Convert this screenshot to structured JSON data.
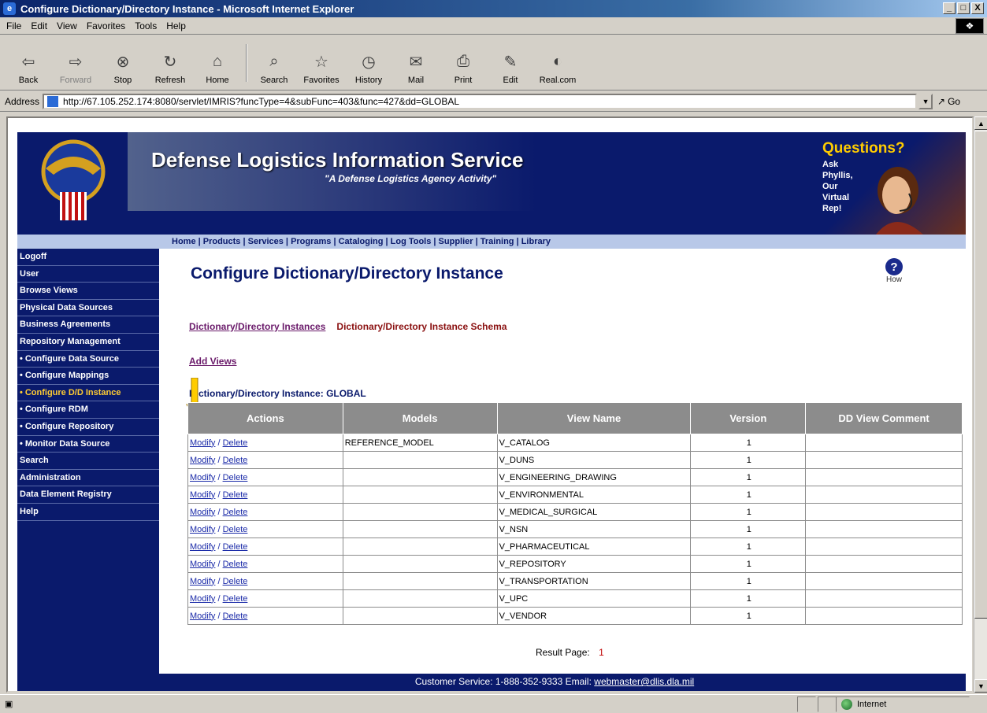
{
  "window": {
    "title": "Configure Dictionary/Directory Instance - Microsoft Internet Explorer",
    "controls": [
      "_",
      "□",
      "X"
    ]
  },
  "menubar": [
    "File",
    "Edit",
    "View",
    "Favorites",
    "Tools",
    "Help"
  ],
  "toolbar": {
    "back": "Back",
    "forward": "Forward",
    "stop": "Stop",
    "refresh": "Refresh",
    "home": "Home",
    "search": "Search",
    "favorites": "Favorites",
    "history": "History",
    "mail": "Mail",
    "print": "Print",
    "edit": "Edit",
    "real": "Real.com"
  },
  "address": {
    "label": "Address",
    "url": "http://67.105.252.174:8080/servlet/IMRIS?funcType=4&subFunc=403&func=427&dd=GLOBAL",
    "go": "Go"
  },
  "banner": {
    "title": "Defense Logistics Information Service",
    "subtitle": "\"A Defense Logistics Agency Activity\"",
    "questions_title": "Questions?",
    "questions_text": "Ask Phyllis, Our Virtual Rep!"
  },
  "nav": "Home | Products | Services | Programs | Cataloging | Log Tools | Supplier | Training | Library",
  "sidebar": [
    {
      "label": "Logoff",
      "sub": false,
      "active": false
    },
    {
      "label": "User",
      "sub": false,
      "active": false
    },
    {
      "label": "Browse Views",
      "sub": false,
      "active": false
    },
    {
      "label": "Physical Data Sources",
      "sub": false,
      "active": false
    },
    {
      "label": "Business Agreements",
      "sub": false,
      "active": false
    },
    {
      "label": "Repository Management",
      "sub": false,
      "active": false
    },
    {
      "label": "Configure Data Source",
      "sub": true,
      "active": false
    },
    {
      "label": "Configure Mappings",
      "sub": true,
      "active": false
    },
    {
      "label": "Configure D/D Instance",
      "sub": true,
      "active": true
    },
    {
      "label": "Configure RDM",
      "sub": true,
      "active": false
    },
    {
      "label": "Configure Repository",
      "sub": true,
      "active": false
    },
    {
      "label": "Monitor Data Source",
      "sub": true,
      "active": false
    },
    {
      "label": "Search",
      "sub": false,
      "active": false
    },
    {
      "label": "Administration",
      "sub": false,
      "active": false
    },
    {
      "label": "Data Element Registry",
      "sub": false,
      "active": false
    },
    {
      "label": "Help",
      "sub": false,
      "active": false
    }
  ],
  "main": {
    "title": "Configure Dictionary/Directory Instance",
    "help_label": "How",
    "tab_instances": "Dictionary/Directory Instances",
    "tab_schema": "Dictionary/Directory Instance Schema",
    "add_views": "Add Views",
    "instance_label": "Dictionary/Directory Instance:",
    "instance_value": "GLOBAL",
    "columns": [
      "Actions",
      "Models",
      "View Name",
      "Version",
      "DD View Comment"
    ],
    "modify_label": "Modify",
    "delete_label": "Delete",
    "rows": [
      {
        "model": "REFERENCE_MODEL",
        "view": "V_CATALOG",
        "version": "1",
        "comment": ""
      },
      {
        "model": "",
        "view": "V_DUNS",
        "version": "1",
        "comment": ""
      },
      {
        "model": "",
        "view": "V_ENGINEERING_DRAWING",
        "version": "1",
        "comment": ""
      },
      {
        "model": "",
        "view": "V_ENVIRONMENTAL",
        "version": "1",
        "comment": ""
      },
      {
        "model": "",
        "view": "V_MEDICAL_SURGICAL",
        "version": "1",
        "comment": ""
      },
      {
        "model": "",
        "view": "V_NSN",
        "version": "1",
        "comment": ""
      },
      {
        "model": "",
        "view": "V_PHARMACEUTICAL",
        "version": "1",
        "comment": ""
      },
      {
        "model": "",
        "view": "V_REPOSITORY",
        "version": "1",
        "comment": ""
      },
      {
        "model": "",
        "view": "V_TRANSPORTATION",
        "version": "1",
        "comment": ""
      },
      {
        "model": "",
        "view": "V_UPC",
        "version": "1",
        "comment": ""
      },
      {
        "model": "",
        "view": "V_VENDOR",
        "version": "1",
        "comment": ""
      }
    ],
    "result_page_label": "Result Page:",
    "result_page_num": "1"
  },
  "footer": {
    "text": "Customer Service: 1-888-352-9333 Email:",
    "email": "webmaster@dlis.dla.mil"
  },
  "status": {
    "zone": "Internet"
  },
  "colors": {
    "navy": "#0a1a6c",
    "header_gray": "#8c8c8c",
    "active_yellow": "#ffcc33",
    "arrow": "#ffcc00"
  }
}
